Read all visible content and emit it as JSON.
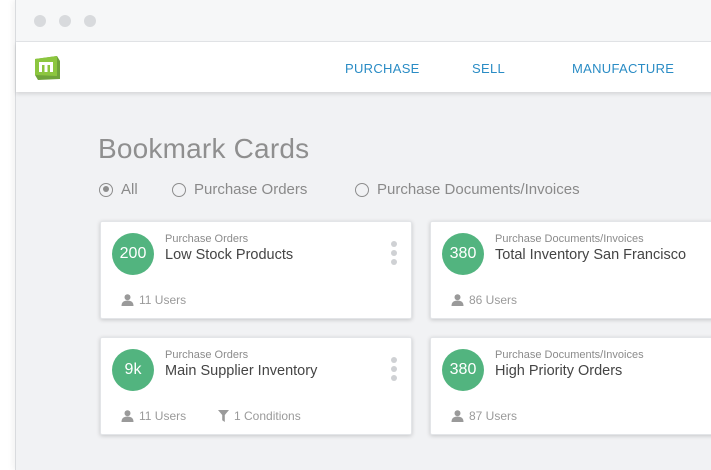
{
  "nav": {
    "items": [
      "PURCHASE",
      "SELL",
      "MANUFACTURE"
    ]
  },
  "page": {
    "title": "Bookmark Cards"
  },
  "filters": [
    {
      "label": "All",
      "selected": true
    },
    {
      "label": "Purchase Orders",
      "selected": false
    },
    {
      "label": "Purchase Documents/Invoices",
      "selected": false
    }
  ],
  "cards": [
    {
      "count": "200",
      "category": "Purchase Orders",
      "title": "Low Stock Products",
      "users": "11 Users",
      "conditions": ""
    },
    {
      "count": "380",
      "category": "Purchase Documents/Invoices",
      "title": "Total Inventory San Francisco",
      "users": "86 Users",
      "conditions": ""
    },
    {
      "count": "9k",
      "category": "Purchase Orders",
      "title": "Main Supplier Inventory",
      "users": "11 Users",
      "conditions": "1 Conditions"
    },
    {
      "count": "380",
      "category": "Purchase Documents/Invoices",
      "title": "High Priority Orders",
      "users": "87 Users",
      "conditions": ""
    }
  ],
  "colors": {
    "accent": "#2a8cc5",
    "count_badge": "#52b47f",
    "logo": "#8cc63f"
  },
  "icons": {
    "users": "user-icon",
    "conditions": "filter-icon",
    "menu": "kebab-menu-icon",
    "logo": "app-logo"
  }
}
